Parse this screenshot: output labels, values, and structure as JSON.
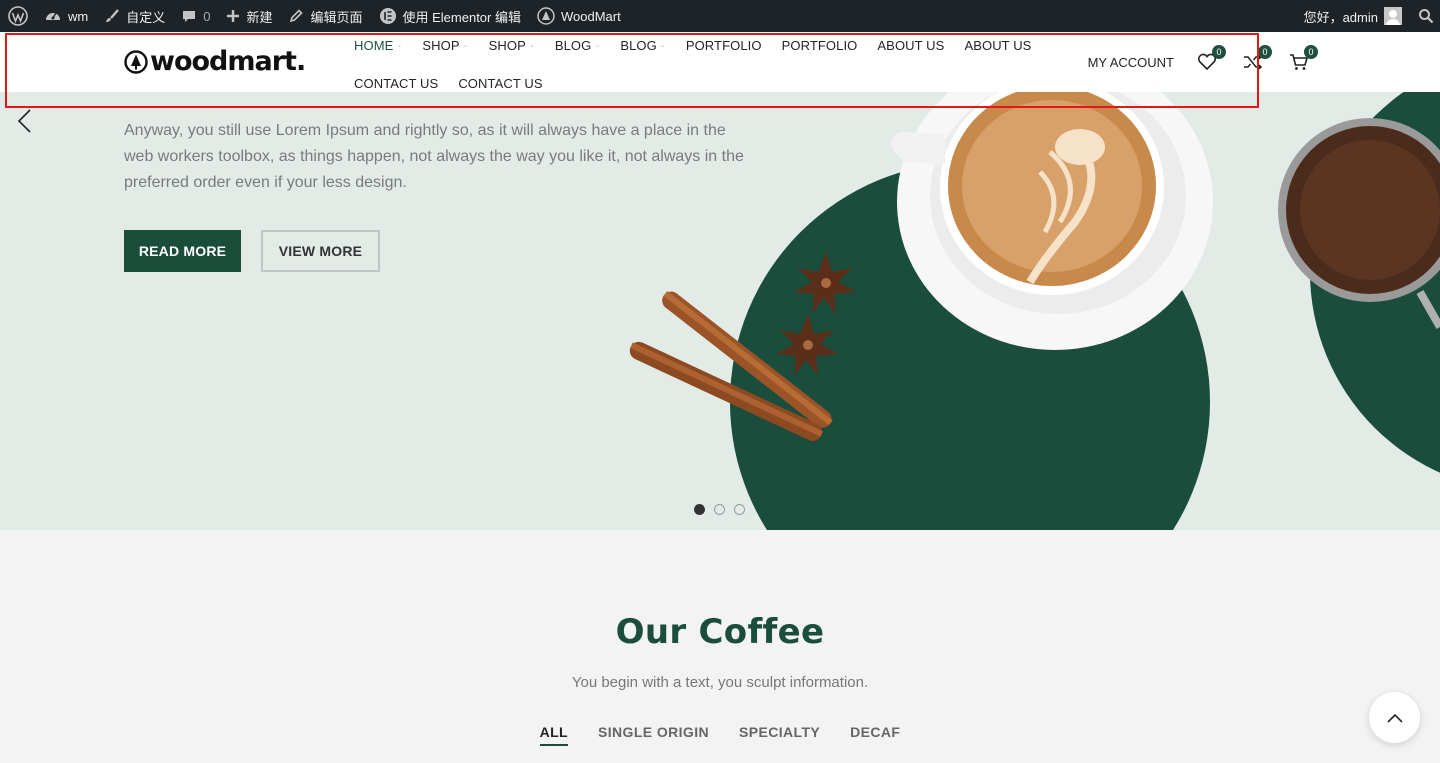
{
  "adminbar": {
    "site_name": "wm",
    "customize": "自定义",
    "comments_count": "0",
    "new": "新建",
    "edit_page": "编辑页面",
    "elementor_edit": "使用 Elementor 编辑",
    "theme": "WoodMart",
    "greeting": "您好，admin"
  },
  "header": {
    "logo": "woodmart.",
    "nav_row1": [
      "HOME",
      "SHOP",
      "SHOP",
      "BLOG",
      "BLOG",
      "PORTFOLIO",
      "PORTFOLIO",
      "ABOUT US",
      "ABOUT US"
    ],
    "nav_row2": [
      "CONTACT US",
      "CONTACT US"
    ],
    "my_account": "MY ACCOUNT",
    "wishlist_count": "0",
    "compare_count": "0",
    "cart_count": "0"
  },
  "hero": {
    "text": "Anyway, you still use Lorem Ipsum and rightly so, as it will always have a place in the web workers toolbox, as things happen, not always the way you like it, not always in the preferred order even if your less design.",
    "read_more": "READ MORE",
    "view_more": "VIEW MORE",
    "slides": 3,
    "active_slide": 1
  },
  "coffee": {
    "title": "Our Coffee",
    "subtitle": "You begin with a text, you sculpt information.",
    "tabs": [
      "ALL",
      "SINGLE ORIGIN",
      "SPECIALTY",
      "DECAF"
    ]
  },
  "colors": {
    "brand_green": "#1b4d3b",
    "hero_bg": "#e3ebe7",
    "highlight_red": "#e01818"
  }
}
